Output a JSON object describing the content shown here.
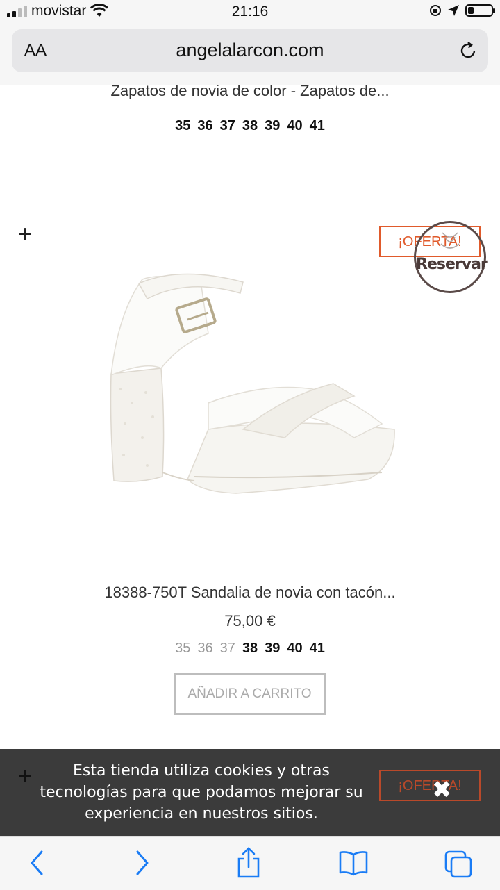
{
  "status_bar": {
    "carrier": "movistar",
    "time": "21:16"
  },
  "browser": {
    "text_size_label": "AA",
    "url": "angelalarcon.com"
  },
  "previous_product": {
    "title": "Zapatos de novia de color - Zapatos de...",
    "sizes": [
      {
        "label": "35",
        "available": true
      },
      {
        "label": "36",
        "available": true
      },
      {
        "label": "37",
        "available": true
      },
      {
        "label": "38",
        "available": true
      },
      {
        "label": "39",
        "available": true
      },
      {
        "label": "40",
        "available": true
      },
      {
        "label": "41",
        "available": true
      }
    ]
  },
  "product": {
    "badge": "¡OFERTA!",
    "stamp": "Reservar",
    "title": "18388-750T Sandalia de novia con tacón...",
    "price": "75,00 €",
    "sizes": [
      {
        "label": "35",
        "available": false
      },
      {
        "label": "36",
        "available": false
      },
      {
        "label": "37",
        "available": false
      },
      {
        "label": "38",
        "available": true
      },
      {
        "label": "39",
        "available": true
      },
      {
        "label": "40",
        "available": true
      },
      {
        "label": "41",
        "available": true
      }
    ],
    "add_to_cart": "AÑADIR A CARRITO"
  },
  "next_product": {
    "badge": "¡OFERTA!"
  },
  "plus_symbol": "+",
  "cookie_banner": {
    "text": "Esta tienda utiliza cookies y otras tecnologías para que podamos mejorar su experiencia en nuestros sitios.",
    "close_symbol": "✖"
  },
  "toolbar": {
    "icons": [
      "back-icon",
      "forward-icon",
      "share-icon",
      "bookmarks-icon",
      "tabs-icon"
    ]
  },
  "colors": {
    "accent_link": "#1a7cf5",
    "offer": "#e05a2b",
    "cookie_bg": "#3b3b3b"
  }
}
